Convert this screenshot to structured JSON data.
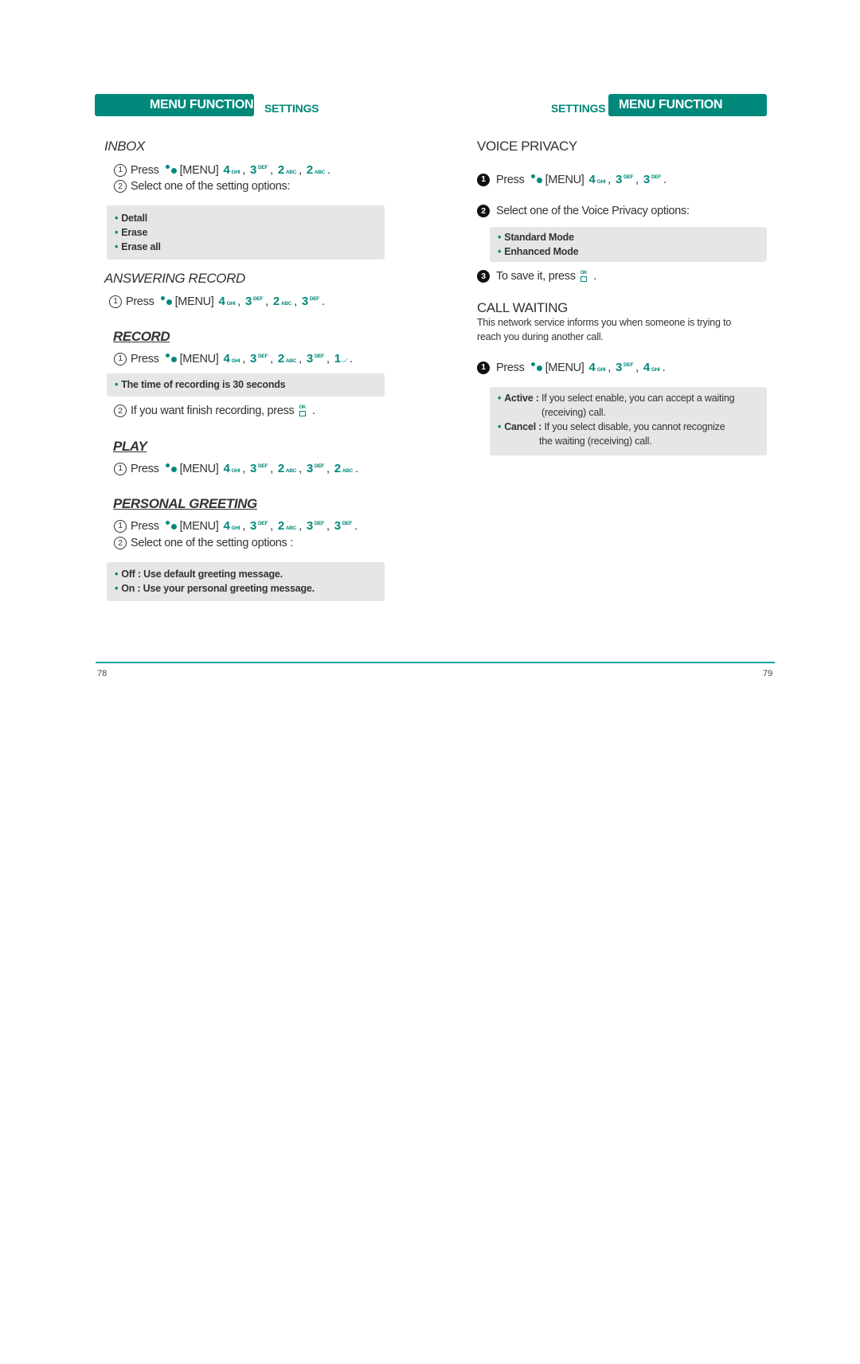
{
  "header": {
    "left_bar": "MENU FUNCTION",
    "left_sub": "SETTINGS",
    "right_sub": "SETTINGS",
    "right_bar": "MENU FUNCTION"
  },
  "common": {
    "press": "Press",
    "menu": "[MENU]",
    "comma": ",",
    "period": ".",
    "ok_label": "OK"
  },
  "left": {
    "inbox": {
      "title": "INBOX",
      "step1_num": "1",
      "keys": [
        {
          "digit": "4",
          "letters": "GHI",
          "pos": "sub"
        },
        {
          "digit": "3",
          "letters": "DEF",
          "pos": "sup"
        },
        {
          "digit": "2",
          "letters": "ABC",
          "pos": "sub"
        },
        {
          "digit": "2",
          "letters": "ABC",
          "pos": "sub"
        }
      ],
      "step2_num": "2",
      "step2": "Select one of the setting options:",
      "options": [
        "Detall",
        "Erase",
        "Erase all"
      ]
    },
    "answering_record": {
      "title": "ANSWERING RECORD",
      "step1_num": "1",
      "keys": [
        {
          "digit": "4",
          "letters": "GHI",
          "pos": "sub"
        },
        {
          "digit": "3",
          "letters": "DEF",
          "pos": "sup"
        },
        {
          "digit": "2",
          "letters": "ABC",
          "pos": "sub"
        },
        {
          "digit": "3",
          "letters": "DEF",
          "pos": "sup"
        }
      ]
    },
    "record": {
      "title": "RECORD",
      "step1_num": "1",
      "keys": [
        {
          "digit": "4",
          "letters": "GHI",
          "pos": "sub"
        },
        {
          "digit": "3",
          "letters": "DEF",
          "pos": "sup"
        },
        {
          "digit": "2",
          "letters": "ABC",
          "pos": "sub"
        },
        {
          "digit": "3",
          "letters": "DEF",
          "pos": "sup"
        },
        {
          "digit": "1",
          "letters": ".–'",
          "pos": "sub"
        }
      ],
      "note": "The time of recording is 30 seconds",
      "step2_num": "2",
      "step2": "If you want finish recording, press"
    },
    "play": {
      "title": "PLAY",
      "step1_num": "1",
      "keys": [
        {
          "digit": "4",
          "letters": "GHI",
          "pos": "sub"
        },
        {
          "digit": "3",
          "letters": "DEF",
          "pos": "sup"
        },
        {
          "digit": "2",
          "letters": "ABC",
          "pos": "sub"
        },
        {
          "digit": "3",
          "letters": "DEF",
          "pos": "sup"
        },
        {
          "digit": "2",
          "letters": "ABC",
          "pos": "sub"
        }
      ]
    },
    "personal_greeting": {
      "title": "PERSONAL GREETING",
      "step1_num": "1",
      "keys": [
        {
          "digit": "4",
          "letters": "GHI",
          "pos": "sub"
        },
        {
          "digit": "3",
          "letters": "DEF",
          "pos": "sup"
        },
        {
          "digit": "2",
          "letters": "ABC",
          "pos": "sub"
        },
        {
          "digit": "3",
          "letters": "DEF",
          "pos": "sup"
        },
        {
          "digit": "3",
          "letters": "DEF",
          "pos": "sup"
        }
      ],
      "step2_num": "2",
      "step2": "Select one of the setting options :",
      "options": [
        "Off : Use default greeting message.",
        "On : Use your personal greeting message."
      ]
    }
  },
  "right": {
    "voice_privacy": {
      "title": "VOICE PRIVACY",
      "step1_num": "1",
      "keys": [
        {
          "digit": "4",
          "letters": "GHI",
          "pos": "sub"
        },
        {
          "digit": "3",
          "letters": "DEF",
          "pos": "sup"
        },
        {
          "digit": "3",
          "letters": "DEF",
          "pos": "sup"
        }
      ],
      "step2_num": "2",
      "step2": "Select one of the Voice Privacy options:",
      "options": [
        "Standard Mode",
        "Enhanced Mode"
      ],
      "step3_num": "3",
      "step3": "To save it, press"
    },
    "call_waiting": {
      "title": "CALL WAITING",
      "description_line1": "This network service informs you when someone is trying to",
      "description_line2": "reach you during another call.",
      "step1_num": "1",
      "keys": [
        {
          "digit": "4",
          "letters": "GHI",
          "pos": "sub"
        },
        {
          "digit": "3",
          "letters": "DEF",
          "pos": "sup"
        },
        {
          "digit": "4",
          "letters": "GHI",
          "pos": "sub"
        }
      ],
      "options": [
        {
          "label": "Active :",
          "text": "If you select enable, you can accept a waiting",
          "cont": "(receiving) call."
        },
        {
          "label": "Cancel :",
          "text": "If you select disable, you cannot recognize",
          "cont": "the waiting (receiving) call."
        }
      ]
    }
  },
  "footer": {
    "left_page": "78",
    "right_page": "79"
  },
  "colors": {
    "accent": "#00897b",
    "rule": "#17a69a",
    "box_bg": "#e6e6e6",
    "text": "#333333"
  }
}
